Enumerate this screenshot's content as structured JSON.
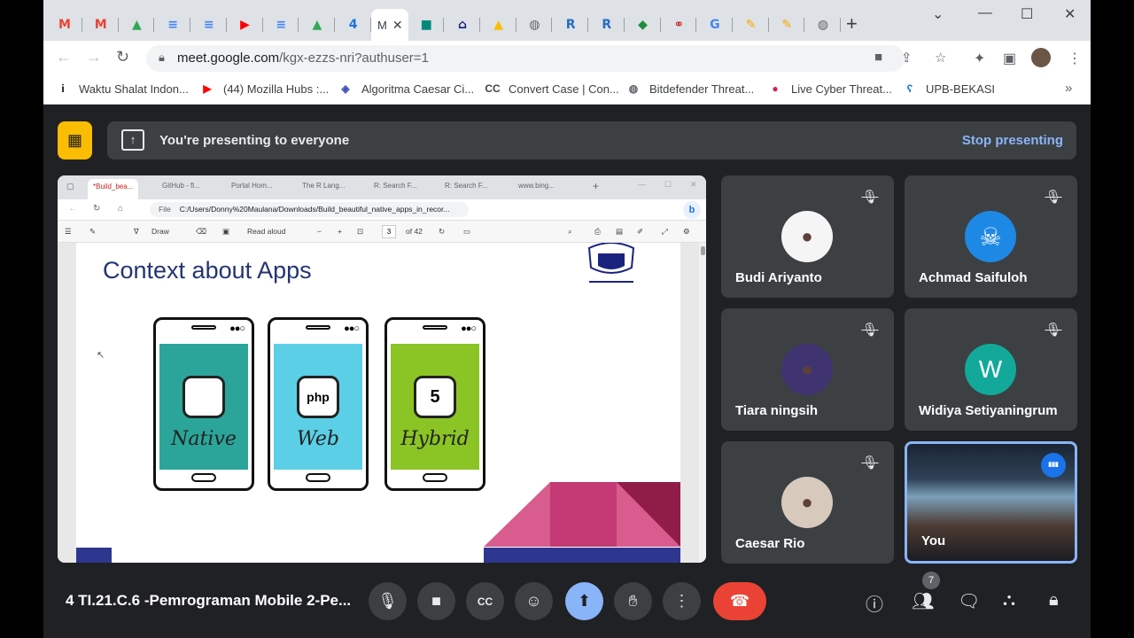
{
  "browser": {
    "tabs": [
      {
        "icon": "gmail-icon",
        "glyph": "M",
        "color": "#ea4335"
      },
      {
        "icon": "gmail-icon",
        "glyph": "M",
        "color": "#ea4335"
      },
      {
        "icon": "drive-icon",
        "glyph": "▲",
        "color": "#34a853"
      },
      {
        "icon": "docs-icon",
        "glyph": "≡",
        "color": "#4285f4"
      },
      {
        "icon": "docs-icon",
        "glyph": "≡",
        "color": "#4285f4"
      },
      {
        "icon": "youtube-icon",
        "glyph": "▶",
        "color": "#ff0000"
      },
      {
        "icon": "docs-icon",
        "glyph": "≡",
        "color": "#4285f4"
      },
      {
        "icon": "drive-icon",
        "glyph": "▲",
        "color": "#34a853"
      },
      {
        "icon": "calendar-icon",
        "glyph": "4",
        "color": "#1a73e8"
      },
      {
        "icon": "meet-icon",
        "label": "M",
        "active": true
      },
      {
        "icon": "meet-icon",
        "glyph": "■",
        "color": "#00897b"
      },
      {
        "icon": "university-icon",
        "glyph": "⌂",
        "color": "#1a237e"
      },
      {
        "icon": "drive-icon",
        "glyph": "▲",
        "color": "#fbbc04"
      },
      {
        "icon": "globe-icon",
        "glyph": "◍",
        "color": "#5f6368"
      },
      {
        "icon": "r-icon",
        "glyph": "R",
        "color": "#276dc3"
      },
      {
        "icon": "r-icon",
        "glyph": "R",
        "color": "#276dc3"
      },
      {
        "icon": "green-diamond-icon",
        "glyph": "◆",
        "color": "#1e8e3e"
      },
      {
        "icon": "cycle-icon",
        "glyph": "⚭",
        "color": "#c5221f"
      },
      {
        "icon": "google-icon",
        "glyph": "G",
        "color": "#4285f4"
      },
      {
        "icon": "colorful-icon",
        "glyph": "✎",
        "color": "#f9ab00"
      },
      {
        "icon": "colorful-icon",
        "glyph": "✎",
        "color": "#f9ab00"
      },
      {
        "icon": "globe-icon",
        "glyph": "◍",
        "color": "#5f6368"
      }
    ],
    "url_host": "meet.google.com",
    "url_path": "/kgx-ezzs-nri?authuser=1",
    "bookmarks": [
      {
        "label": "Waktu Shalat Indon...",
        "icon": "bookmark-waktu-icon",
        "glyph": "i",
        "color": "#000"
      },
      {
        "label": "(44) Mozilla Hubs :...",
        "icon": "youtube-icon",
        "glyph": "▶",
        "color": "#ff0000"
      },
      {
        "label": "Algoritma Caesar Ci...",
        "icon": "caesar-icon",
        "glyph": "◈",
        "color": "#3f51b5"
      },
      {
        "label": "Convert Case | Con...",
        "icon": "convert-case-icon",
        "glyph": "CC",
        "color": "#444"
      },
      {
        "label": "Bitdefender Threat...",
        "icon": "globe-icon",
        "glyph": "◍",
        "color": "#5f6368"
      },
      {
        "label": "Live Cyber Threat...",
        "icon": "cyber-threat-icon",
        "glyph": "●",
        "color": "#d81b60"
      },
      {
        "label": "UPB-BEKASI",
        "icon": "upb-icon",
        "glyph": "ʕ",
        "color": "#1a73e8"
      }
    ],
    "bookmarks_more": "»"
  },
  "banner": {
    "text": "You're presenting to everyone",
    "stop": "Stop presenting"
  },
  "shared": {
    "tabs": [
      "*Build_bea...",
      "GitHub - fl...",
      "Portal Hom...",
      "The R Lang...",
      "R: Search F...",
      "R: Search F...",
      "www.bing..."
    ],
    "file_label": "File",
    "url": "C:/Users/Donny%20Maulana/Downloads/Build_beautiful_native_apps_in_recor...",
    "pdf_draw": "Draw",
    "pdf_read": "Read aloud",
    "pdf_page": "3",
    "pdf_of": "of 42",
    "slide_title": "Context about Apps",
    "phones": [
      {
        "label": "Native",
        "color": "#2ba59a"
      },
      {
        "label": "Web",
        "color": "#5bcfe6"
      },
      {
        "label": "Hybrid",
        "color": "#8bc425"
      }
    ]
  },
  "participants": [
    {
      "name": "Budi Ariyanto",
      "avatar": "photo",
      "color": "#f5f5f5",
      "muted": true
    },
    {
      "name": "Achmad Saifuloh",
      "avatar": "skull",
      "color": "#1e88e5",
      "muted": true
    },
    {
      "name": "Tiara ningsih",
      "avatar": "photo",
      "color": "#3f3470",
      "muted": true
    },
    {
      "name": "Widiya Setiyaningrum",
      "avatar": "W",
      "color": "#12a99a",
      "muted": true
    },
    {
      "name": "Caesar Rio",
      "avatar": "photo",
      "color": "#d7c9bb",
      "muted": true
    },
    {
      "name": "You",
      "avatar": "video",
      "speaking": true
    }
  ],
  "bottom": {
    "meeting_name": "4 TI.21.C.6 -Pemrograman Mobile 2-Pe...",
    "people_count": "7"
  }
}
